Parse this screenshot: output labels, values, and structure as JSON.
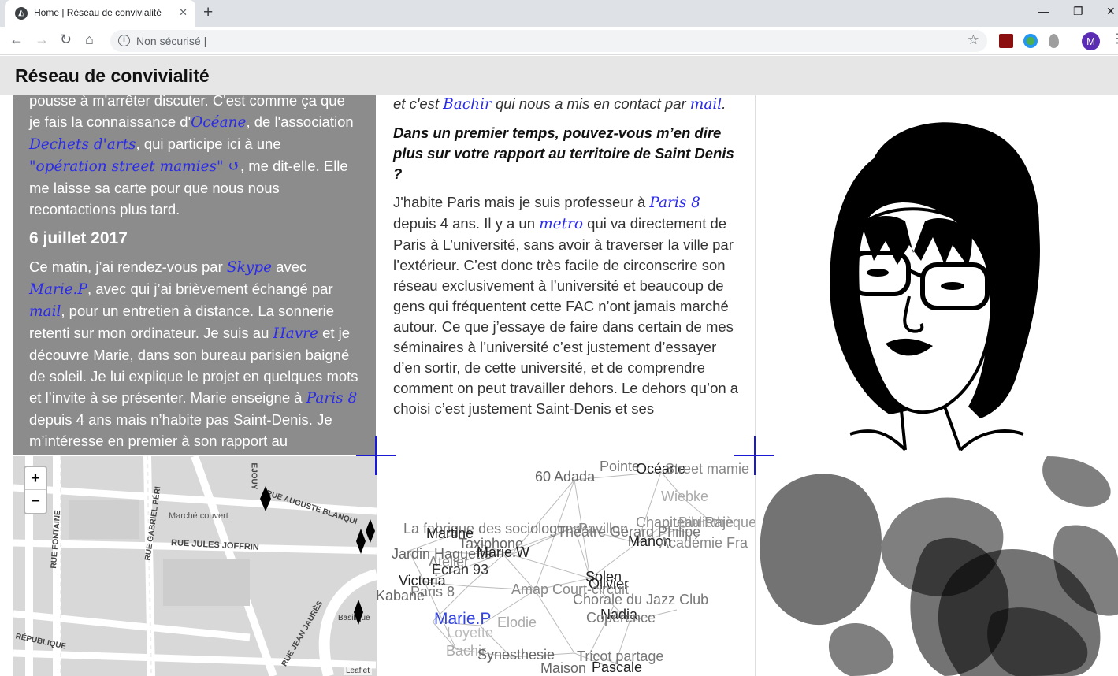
{
  "browser": {
    "tab_title": "Home | Réseau de convivialité",
    "tab_close": "✕",
    "new_tab": "+",
    "omnibox_text": "Non sécurisé |",
    "avatar_letter": "M"
  },
  "site": {
    "title": "Réseau de convivialité"
  },
  "left_panel": {
    "p1": [
      {
        "t": "pousse à m'arrêter discuter. C'est comme ça que je fais la connaissance d'"
      },
      {
        "l": "Océane"
      },
      {
        "t": ", de l'association "
      },
      {
        "l": "Dechets d'arts"
      },
      {
        "t": ", qui participe ici à une "
      },
      {
        "l": "\"opération street mamies\" ↺"
      },
      {
        "t": ", me dit-elle. Elle me laisse sa carte pour que nous nous recontactions plus tard."
      }
    ],
    "date": "6 juillet 2017",
    "p2": [
      {
        "t": "Ce matin, j’ai rendez-vous par "
      },
      {
        "l": "Skype"
      },
      {
        "t": " avec "
      },
      {
        "l": "Marie.P"
      },
      {
        "t": ", avec qui j’ai brièvement échangé par "
      },
      {
        "l": "mail"
      },
      {
        "t": ", pour un entretien à distance. La sonnerie retenti sur mon ordinateur. Je suis au "
      },
      {
        "l": "Havre"
      },
      {
        "t": " et je découvre Marie, dans son bureau parisien baigné de soleil. Je lui explique le projet en quelques mots et l’invite à se présenter. Marie enseigne à "
      },
      {
        "l": "Paris 8"
      },
      {
        "t": " depuis 4 ans mais n’habite pas Saint-Denis. Je m’intéresse en premier à son rapport au"
      }
    ]
  },
  "mid_panel": {
    "lead": [
      {
        "t": "et c'est "
      },
      {
        "l": "Bachir"
      },
      {
        "t": " qui nous a mis en contact par "
      },
      {
        "l": "mail"
      },
      {
        "t": "."
      }
    ],
    "question": "Dans un premier temps, pouvez-vous m’en dire plus sur votre rapport au territoire de Saint Denis ?",
    "answer": [
      {
        "t": "J'habite Paris mais je suis professeur à "
      },
      {
        "l": "Paris 8"
      },
      {
        "t": " depuis 4 ans. Il y a un "
      },
      {
        "l": "metro"
      },
      {
        "t": " qui va directement de Paris à L’université, sans avoir à traverser la ville par l’extérieur. C’est donc très facile de circonscrire son réseau exclusivement à l’université et beaucoup de gens qui fréquentent cette FAC n’ont jamais marché autour. Ce que j’essaye de faire dans certain de mes séminaires à l’université c’est justement d’essayer d’en sortir, de cette université, et de comprendre comment on peut travailler dehors. Le dehors qu’on a choisi c’est justement Saint-Denis et ses"
      }
    ]
  },
  "map": {
    "zoom_in": "+",
    "zoom_out": "−",
    "attribution": "Leaflet",
    "streets": [
      "RUE AUGUSTE BLANQUI",
      "RUE JULES JOFFRIN",
      "RUE GABRIEL PÉRI",
      "RUE FONTAINE",
      "Marché couvert",
      "RUE JEAN JAURÈS",
      "RÉPUBLIQUE",
      "Basilique",
      "EJOUY"
    ]
  },
  "network": {
    "labels": [
      {
        "text": "60 Adada",
        "c": "#666"
      },
      {
        "text": "Pointe",
        "c": "#777"
      },
      {
        "text": "Océane",
        "c": "#222"
      },
      {
        "text": "Street mamie",
        "c": "#888"
      },
      {
        "text": "Wiebke",
        "c": "#aaa"
      },
      {
        "text": "La fabrique des sociologues",
        "c": "#777"
      },
      {
        "text": "Pavillon",
        "c": "#888"
      },
      {
        "text": "Théâtre Gérard Philipe",
        "c": "#777"
      },
      {
        "text": "Chapiteau Raje",
        "c": "#888"
      },
      {
        "text": "Bibliothèque",
        "c": "#999"
      },
      {
        "text": "Martine",
        "c": "#222"
      },
      {
        "text": "Manon",
        "c": "#222"
      },
      {
        "text": "Académie Fra",
        "c": "#888"
      },
      {
        "text": "Taxiphone",
        "c": "#666"
      },
      {
        "text": "Jardin Haguette",
        "c": "#666"
      },
      {
        "text": "Marie.W",
        "c": "#222"
      },
      {
        "text": "Atelier",
        "c": "#888"
      },
      {
        "text": "Ecran 93",
        "c": "#333"
      },
      {
        "text": "Solen",
        "c": "#222"
      },
      {
        "text": "Victoria",
        "c": "#222"
      },
      {
        "text": "Olivier",
        "c": "#222"
      },
      {
        "text": "Amap Court-circuit",
        "c": "#888"
      },
      {
        "text": "Paris 8",
        "c": "#777"
      },
      {
        "text": "Kabane",
        "c": "#666"
      },
      {
        "text": "Chorale du Jazz Club",
        "c": "#777"
      },
      {
        "text": "Nadia",
        "c": "#222"
      },
      {
        "text": "Marie.P",
        "c": "#3344dd"
      },
      {
        "text": "Elodie",
        "c": "#aaa"
      },
      {
        "text": "Copérence",
        "c": "#777"
      },
      {
        "text": "Loyette",
        "c": "#bbb"
      },
      {
        "text": "Bachir",
        "c": "#aaa"
      },
      {
        "text": "Synesthesie",
        "c": "#666"
      },
      {
        "text": "Tricot partage",
        "c": "#777"
      },
      {
        "text": "Maison",
        "c": "#666"
      },
      {
        "text": "Pascale",
        "c": "#222"
      }
    ]
  }
}
